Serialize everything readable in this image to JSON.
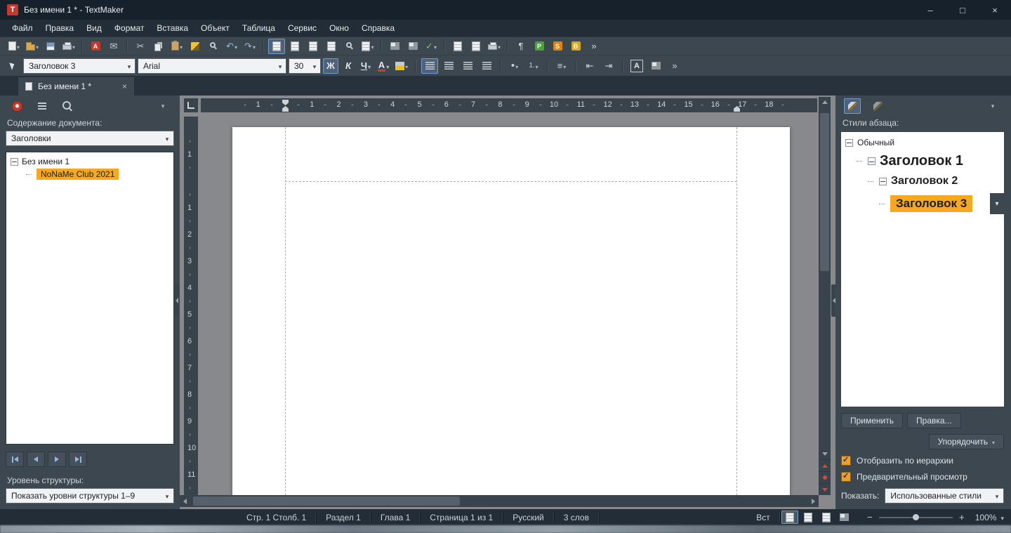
{
  "window": {
    "title": "Без имени 1 * - TextMaker",
    "app_icon_letter": "T",
    "controls": {
      "minimize": "–",
      "maximize": "□",
      "close": "×"
    }
  },
  "menu": {
    "items": [
      "Файл",
      "Правка",
      "Вид",
      "Формат",
      "Вставка",
      "Объект",
      "Таблица",
      "Сервис",
      "Окно",
      "Справка"
    ]
  },
  "toolbar_standard": {
    "items": [
      {
        "name": "new-document-icon",
        "icon": "page",
        "dropdown": true
      },
      {
        "name": "open-icon",
        "icon": "folder",
        "dropdown": true
      },
      {
        "name": "save-icon",
        "icon": "floppy"
      },
      {
        "name": "print-icon",
        "icon": "printer",
        "dropdown": true
      },
      {
        "sep": true
      },
      {
        "name": "export-pdf-icon",
        "icon": "pdf",
        "glyph": "A"
      },
      {
        "name": "send-email-icon",
        "glyph": "✉",
        "color": "#c8ccd0"
      },
      {
        "sep": true
      },
      {
        "name": "cut-icon",
        "glyph": "✂",
        "color": "#c8ccd0"
      },
      {
        "name": "copy-icon",
        "icon": "copy"
      },
      {
        "name": "paste-icon",
        "icon": "clipboard",
        "dropdown": true
      },
      {
        "name": "format-paintbrush-icon",
        "icon": "brush"
      },
      {
        "name": "find-icon",
        "icon": "zoomg"
      },
      {
        "name": "undo-icon",
        "glyph": "↶",
        "color": "#8fb6de",
        "dropdown": true
      },
      {
        "name": "redo-icon",
        "glyph": "↷",
        "color": "#8fb6de",
        "dropdown": true
      },
      {
        "sep": true
      },
      {
        "name": "page-layout-view-icon",
        "icon": "doc",
        "active": true
      },
      {
        "name": "normal-view-icon",
        "icon": "doc"
      },
      {
        "name": "header-icon",
        "icon": "doc"
      },
      {
        "name": "footer-icon",
        "icon": "doc"
      },
      {
        "name": "zoom-level-icon",
        "icon": "zoomg"
      },
      {
        "name": "insert-object-icon",
        "icon": "doc",
        "dropdown": true
      },
      {
        "sep": true
      },
      {
        "name": "insert-table-icon",
        "icon": "grid"
      },
      {
        "name": "insert-chart-icon",
        "icon": "grid"
      },
      {
        "name": "spellcheck-icon",
        "glyph": "✓",
        "color": "#7fbf6a",
        "dropdown": true
      },
      {
        "sep": true
      },
      {
        "name": "track-changes-icon",
        "icon": "doc"
      },
      {
        "name": "comment-icon",
        "icon": "doc"
      },
      {
        "name": "mail-merge-icon",
        "icon": "printer",
        "dropdown": true
      },
      {
        "sep": true
      },
      {
        "name": "formatting-marks-icon",
        "glyph": "¶",
        "color": "#d6dadd"
      },
      {
        "name": "planmaker-icon",
        "icon": "app",
        "glyph": "P",
        "color": "#4f9e3f"
      },
      {
        "name": "presentations-icon",
        "icon": "app",
        "glyph": "S",
        "color": "#e08214"
      },
      {
        "name": "basicmaker-icon",
        "icon": "app",
        "glyph": "B",
        "color": "#d9a81f"
      },
      {
        "name": "toolbar-overflow-icon",
        "glyph": "»",
        "color": "#d6dadd"
      }
    ]
  },
  "toolbar_format": {
    "style_value": "Заголовок 3",
    "font_value": "Arial",
    "size_value": "30",
    "bold_label": "Ж",
    "italic_label": "К",
    "underline_label": "Ч",
    "font_color_label": "A",
    "bullet_glyph": "•",
    "number_glyph": "1.",
    "outline_glyph": "≡",
    "indent_decrease_glyph": "⇤",
    "indent_increase_glyph": "⇥",
    "char_dialog_label": "A",
    "overflow_glyph": "»"
  },
  "tabstrip": {
    "tab_label": "Без имени 1 *",
    "close_label": "×"
  },
  "outline_panel": {
    "contents_label": "Содержание документа:",
    "contents_value": "Заголовки",
    "root_label": "Без имени 1",
    "child_label": "NoNaMe Club 2021",
    "level_label": "Уровень структуры:",
    "level_value": "Показать уровни структуры 1–9"
  },
  "rulers": {
    "horizontal": [
      "1",
      "1",
      "2",
      "3",
      "4",
      "5",
      "6",
      "7",
      "8",
      "9",
      "10",
      "11",
      "12",
      "13",
      "14",
      "15",
      "16",
      "17",
      "18"
    ],
    "vertical": [
      "1",
      "1",
      "2",
      "3",
      "4",
      "5",
      "6",
      "7",
      "8",
      "9",
      "10",
      "11"
    ]
  },
  "styles_panel": {
    "header": "Стили абзаца:",
    "styles": [
      {
        "label": "Обычный",
        "level": 0,
        "px": 12,
        "bold": false,
        "selected": false
      },
      {
        "label": "Заголовок 1",
        "level": 1,
        "px": 20,
        "bold": true,
        "selected": false
      },
      {
        "label": "Заголовок 2",
        "level": 2,
        "px": 16,
        "bold": true,
        "selected": false
      },
      {
        "label": "Заголовок 3",
        "level": 3,
        "px": 17,
        "bold": true,
        "selected": true
      }
    ],
    "apply_label": "Применить",
    "edit_label": "Правка...",
    "organize_label": "Упорядочить",
    "hierarchy_checkbox": "Отобразить по иерархии",
    "preview_checkbox": "Предварительный просмотр",
    "show_label": "Показать:",
    "show_value": "Использованные стили"
  },
  "statusbar": {
    "items": [
      "Стр. 1 Столб. 1",
      "Раздел 1",
      "Глава 1",
      "Страница 1 из 1",
      "Русский",
      "3 слов"
    ],
    "insert_mode": "Вст",
    "zoom_out": "−",
    "zoom_in": "+",
    "zoom_value": "100%"
  },
  "colors": {
    "accent_orange": "#f6a823",
    "titlebar": "#17212b",
    "panel": "#3d474f",
    "canvas": "#87898c"
  }
}
